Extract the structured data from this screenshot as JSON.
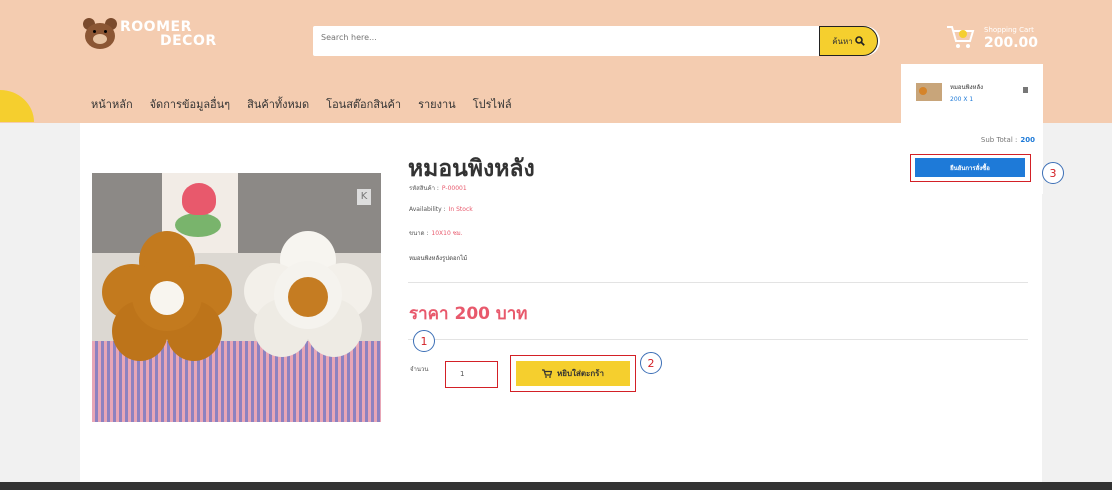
{
  "brand": {
    "line1": "ROOMER",
    "line2": "DECOR"
  },
  "search": {
    "placeholder": "Search here...",
    "button_label": "ค้นหา"
  },
  "cart": {
    "label": "Shopping Cart",
    "total": "200.00"
  },
  "nav": {
    "items": [
      {
        "label": "หน้าหลัก"
      },
      {
        "label": "จัดการข้อมูลอื่นๆ"
      },
      {
        "label": "สินค้าทั้งหมด"
      },
      {
        "label": "โอนสต๊อกสินค้า"
      },
      {
        "label": "รายงาน"
      },
      {
        "label": "โปรไฟล์"
      }
    ]
  },
  "product": {
    "title": "หมอนพิงหลัง",
    "code_label": "รหัสสินค้า :",
    "code_value": "P-00001",
    "availability_label": "Availability :",
    "availability_value": "In Stock",
    "size_label": "ขนาด :",
    "size_value": "10X10 ซม.",
    "description": "หมอนพิงหลังรูปดอกไม้",
    "price": "ราคา 200 บาท",
    "qty_label": "จำนวน",
    "qty_value": "1",
    "add_button": "หยิบใส่ตะกร้า",
    "image_watermark": "K"
  },
  "cart_dropdown": {
    "item_name": "หมอนพิงหลัง",
    "item_qty": "200 X 1",
    "subtotal_label": "Sub Total :",
    "subtotal_value": "200",
    "confirm_button": "ยืนยันการสั่งซื้อ"
  },
  "callouts": [
    "1",
    "2",
    "3"
  ],
  "colors": {
    "header": "#f4ccb0",
    "accent_yellow": "#f5cf2e",
    "price_red": "#e8596c",
    "blue": "#1e7ad8",
    "highlight_border": "#d32026"
  }
}
